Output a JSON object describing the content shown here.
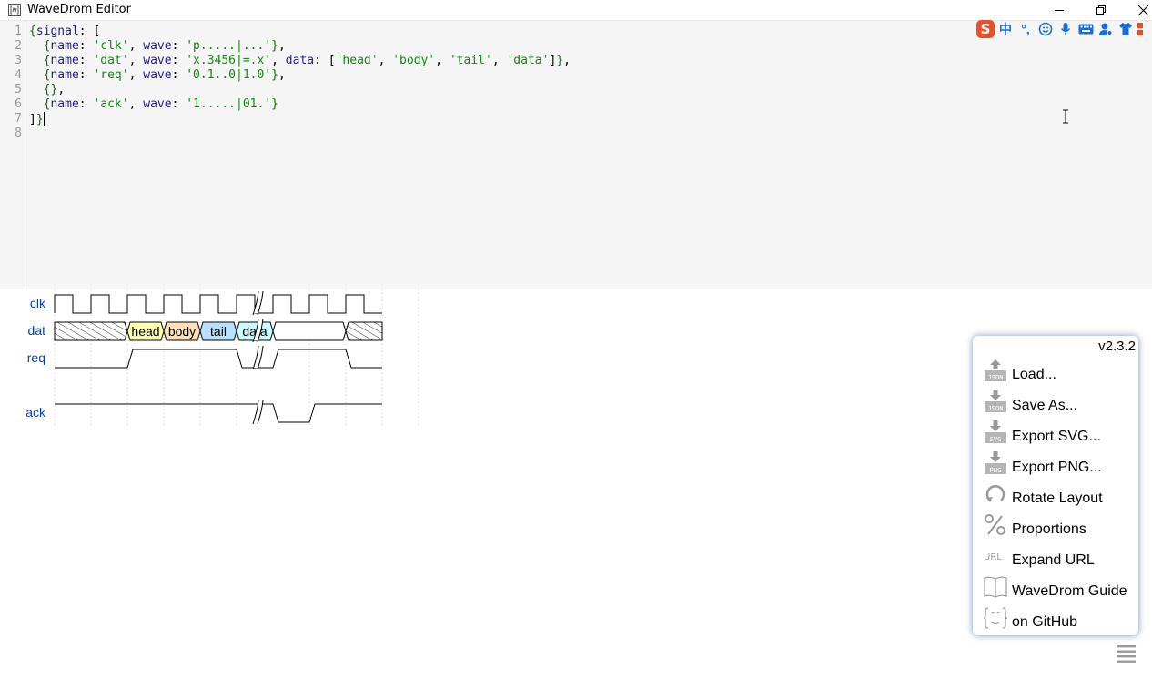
{
  "window": {
    "title": "WaveDrom Editor"
  },
  "editor": {
    "line_numbers": [
      "1",
      "2",
      "3",
      "4",
      "5",
      "6",
      "7",
      "8"
    ],
    "lines": [
      [
        [
          "brace",
          "{"
        ],
        [
          "key",
          "signal"
        ],
        [
          "p",
          ": ["
        ]
      ],
      [
        [
          "p",
          "  "
        ],
        [
          "brace",
          "{"
        ],
        [
          "key",
          "name"
        ],
        [
          "p",
          ": "
        ],
        [
          "str",
          "'clk'"
        ],
        [
          "p",
          ", "
        ],
        [
          "key",
          "wave"
        ],
        [
          "p",
          ": "
        ],
        [
          "str",
          "'p.....|...'"
        ],
        [
          "brace",
          "}"
        ],
        [
          "p",
          ","
        ]
      ],
      [
        [
          "p",
          "  "
        ],
        [
          "brace",
          "{"
        ],
        [
          "key",
          "name"
        ],
        [
          "p",
          ": "
        ],
        [
          "str",
          "'dat'"
        ],
        [
          "p",
          ", "
        ],
        [
          "key",
          "wave"
        ],
        [
          "p",
          ": "
        ],
        [
          "str",
          "'x.3456|=.x'"
        ],
        [
          "p",
          ", "
        ],
        [
          "key",
          "data"
        ],
        [
          "p",
          ": ["
        ],
        [
          "str",
          "'head'"
        ],
        [
          "p",
          ", "
        ],
        [
          "str",
          "'body'"
        ],
        [
          "p",
          ", "
        ],
        [
          "str",
          "'tail'"
        ],
        [
          "p",
          ", "
        ],
        [
          "str",
          "'data'"
        ],
        [
          "p",
          "]"
        ],
        [
          "brace",
          "}"
        ],
        [
          "p",
          ","
        ]
      ],
      [
        [
          "p",
          "  "
        ],
        [
          "brace",
          "{"
        ],
        [
          "key",
          "name"
        ],
        [
          "p",
          ": "
        ],
        [
          "str",
          "'req'"
        ],
        [
          "p",
          ", "
        ],
        [
          "key",
          "wave"
        ],
        [
          "p",
          ": "
        ],
        [
          "str",
          "'0.1..0|1.0'"
        ],
        [
          "brace",
          "}"
        ],
        [
          "p",
          ","
        ]
      ],
      [
        [
          "p",
          "  "
        ],
        [
          "brace",
          "{}"
        ],
        [
          "p",
          ","
        ]
      ],
      [
        [
          "p",
          "  "
        ],
        [
          "brace",
          "{"
        ],
        [
          "key",
          "name"
        ],
        [
          "p",
          ": "
        ],
        [
          "str",
          "'ack'"
        ],
        [
          "p",
          ", "
        ],
        [
          "key",
          "wave"
        ],
        [
          "p",
          ": "
        ],
        [
          "str",
          "'1.....|01.'"
        ],
        [
          "brace",
          "}"
        ]
      ],
      [
        [
          "p",
          "]"
        ],
        [
          "brace",
          "}"
        ]
      ],
      []
    ]
  },
  "waveform": {
    "signals": [
      {
        "name": "clk",
        "wave": "p.....|..."
      },
      {
        "name": "dat",
        "wave": "x.3456|=.x",
        "data": [
          "head",
          "body",
          "tail",
          "data"
        ]
      },
      {
        "name": "req",
        "wave": "0.1..0|1.0"
      },
      {
        "name": "",
        "wave": ""
      },
      {
        "name": "ack",
        "wave": "1.....|01."
      }
    ],
    "data_colors": {
      "3": "#ffffb4",
      "4": "#ffe0b9",
      "5": "#b9e0ff",
      "6": "#ccfdfe",
      "=": "#ffffff"
    },
    "line_color": "#000000",
    "label_color": "#0041c4"
  },
  "menu": {
    "version": "v2.3.2",
    "items": [
      {
        "label": "Load...",
        "icon": "json-upload-icon",
        "badge": "JSON"
      },
      {
        "label": "Save As...",
        "icon": "json-download-icon",
        "badge": "JSON"
      },
      {
        "label": "Export SVG...",
        "icon": "svg-download-icon",
        "badge": "SVG"
      },
      {
        "label": "Export PNG...",
        "icon": "png-download-icon",
        "badge": "PNG"
      },
      {
        "label": "Rotate Layout",
        "icon": "rotate-icon",
        "badge": ""
      },
      {
        "label": "Proportions",
        "icon": "percent-icon",
        "badge": ""
      },
      {
        "label": "Expand URL",
        "icon": "url-icon",
        "badge": "URL"
      },
      {
        "label": "WaveDrom Guide",
        "icon": "book-icon",
        "badge": ""
      },
      {
        "label": "on GitHub",
        "icon": "github-icon",
        "badge": ""
      }
    ]
  },
  "ime_toolbar": {
    "items": [
      "中",
      "°,",
      "☺",
      "mic",
      "keyboard",
      "user",
      "shirt",
      "grid"
    ]
  }
}
